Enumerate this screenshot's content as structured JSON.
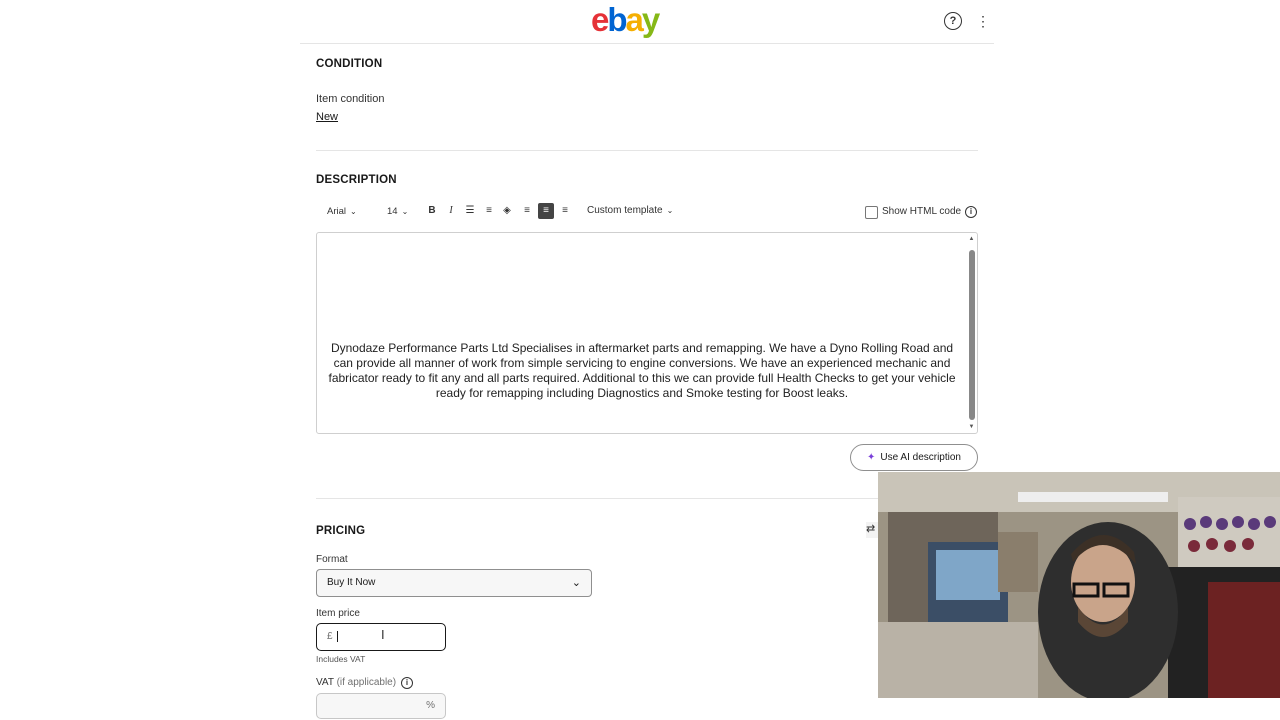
{
  "header": {
    "logo_letters": [
      {
        "ch": "e",
        "color": "#e53238"
      },
      {
        "ch": "b",
        "color": "#0064d2"
      },
      {
        "ch": "a",
        "color": "#f5af02"
      },
      {
        "ch": "y",
        "color": "#86b817"
      }
    ],
    "help_glyph": "?",
    "more_glyph": "⋮"
  },
  "condition": {
    "title": "CONDITION",
    "item_condition_label": "Item condition",
    "item_condition_value": "New"
  },
  "description": {
    "title": "DESCRIPTION",
    "toolbar": {
      "font": "Arial",
      "size": "14",
      "template": "Custom template",
      "buttons": [
        {
          "name": "bold-button",
          "glyph": "B"
        },
        {
          "name": "italic-button",
          "glyph": "I"
        },
        {
          "name": "bulleted-list-button",
          "glyph": "☰"
        },
        {
          "name": "numbered-list-button",
          "glyph": "≡"
        },
        {
          "name": "fill-color-button",
          "glyph": "◈"
        },
        {
          "name": "align-left-button",
          "glyph": "≡"
        },
        {
          "name": "align-center-button",
          "glyph": "≡"
        },
        {
          "name": "align-right-button",
          "glyph": "≡"
        }
      ],
      "show_html_label": "Show HTML code"
    },
    "body_text": "Dynodaze Performance Parts Ltd Specialises in aftermarket parts and remapping. We have a Dyno Rolling Road and can provide all manner of work from simple servicing to engine conversions. We have an experienced mechanic and fabricator ready to fit any and all parts required. Additional to this we can provide full Health Checks to get your vehicle ready for remapping including Diagnostics and Smoke testing for Boost leaks.",
    "ai_button_label": "Use AI description"
  },
  "pricing": {
    "title": "PRICING",
    "format_label": "Format",
    "format_value": "Buy It Now",
    "item_price_label": "Item price",
    "currency_symbol": "£",
    "item_price_value": "",
    "includes_vat": "Includes VAT",
    "vat_label": "VAT",
    "vat_suffix": "(if applicable)",
    "vat_unit": "%"
  },
  "colors": {
    "accent_ai": "#7a3fd9"
  }
}
